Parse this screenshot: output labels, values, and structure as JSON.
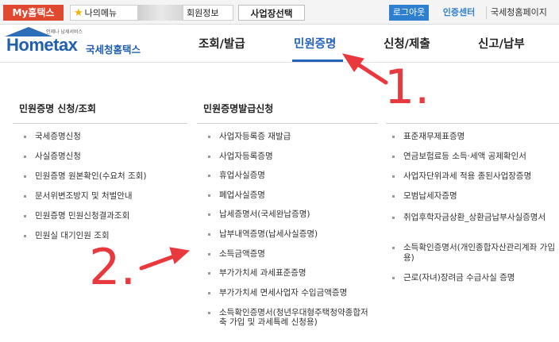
{
  "topbar": {
    "my_tab": "My홈택스",
    "my_menu": "나의메뉴",
    "member_info": "회원정보",
    "business_select": "사업장선택",
    "logout": "로그아웃",
    "cert_center": "인증센터",
    "nts_page": "국세청홈페이지"
  },
  "header": {
    "logo_tagline": "언제나 납세서비스",
    "logo_text": "Hometax",
    "logo_korean": "국세청홈택스",
    "nav": [
      "조회/발급",
      "민원증명",
      "신청/제출",
      "신고/납부"
    ],
    "active_nav": "민원증명"
  },
  "columns": {
    "col1": {
      "title": "민원증명 신청/조회",
      "items": [
        "국세증명신청",
        "사실증명신청",
        "민원증명 원본확인(수요처 조회)",
        "문서위변조방지 및 처벌안내",
        "민원증명 민원신청결과조회",
        "민원실 대기인원 조회"
      ]
    },
    "col2": {
      "title": "민원증명발급신청",
      "items": [
        "사업자등록증 재발급",
        "사업자등록증명",
        "휴업사실증명",
        "폐업사실증명",
        "납세증명서(국세완납증명)",
        "납부내역증명(납세사실증명)",
        "소득금액증명",
        "부가가치세 과세표준증명",
        "부가가치세 면세사업자 수입금액증명",
        "소득확인증명서(청년우대형주택청약종합저축 가입 및 과세특례 신청용)"
      ]
    },
    "col3": {
      "items": [
        "표준재무제표증명",
        "연금보험료등 소득·세액 공제확인서",
        "사업자단위과세 적용 종된사업장증명",
        "모범납세자증명",
        "취업후학자금상환_상환금납부사실증명서",
        "소득확인증명서(개인종합자산관리계좌 가입용)",
        "근로(자녀)장려금 수급사실 증명"
      ]
    }
  },
  "annotations": {
    "step1": "1.",
    "step2": "2.",
    "color": "#e8393f"
  },
  "colors": {
    "accent": "#2563b8",
    "my_tab": "#e0482f",
    "logout": "#2f7fd0"
  }
}
